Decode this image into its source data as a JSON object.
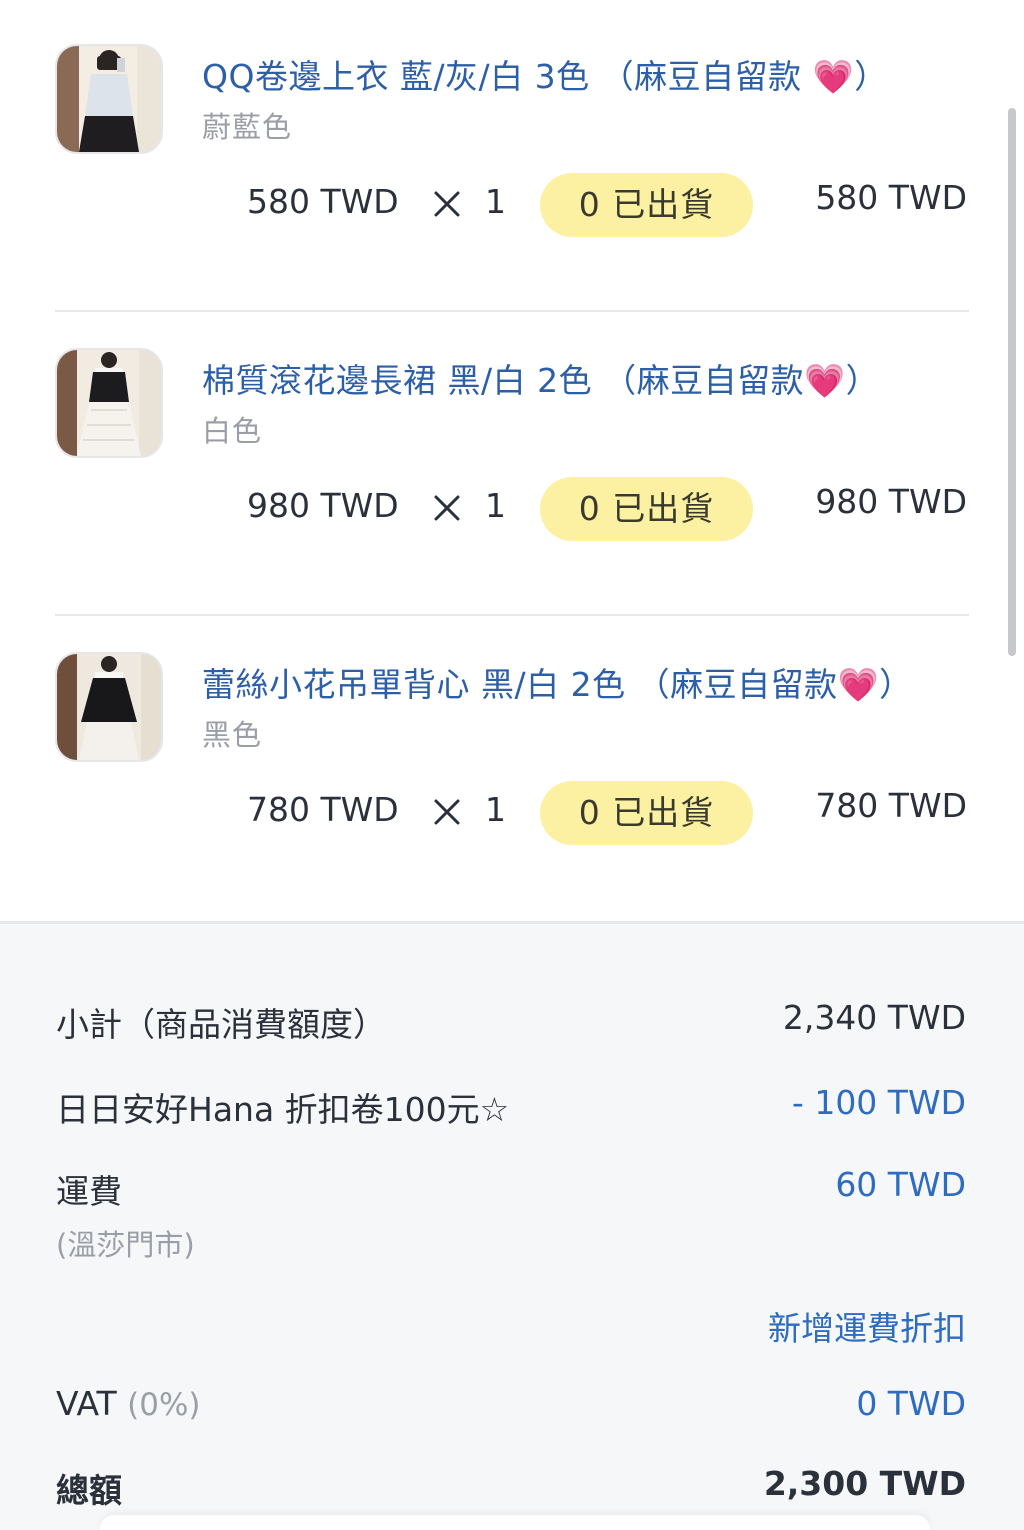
{
  "items": [
    {
      "title": "QQ卷邊上衣 藍/灰/白 3色 （麻豆自留款 💗）",
      "variant": "蔚藍色",
      "unit_price": "580 TWD",
      "times": "×",
      "quantity": "1",
      "status": "0 已出貨",
      "line_total": "580 TWD",
      "thumbnail_icon": "product-photo-blouse"
    },
    {
      "title": "棉質滾花邊長裙 黑/白 2色 （麻豆自留款💗）",
      "variant": "白色",
      "unit_price": "980 TWD",
      "times": "×",
      "quantity": "1",
      "status": "0 已出貨",
      "line_total": "980 TWD",
      "thumbnail_icon": "product-photo-skirt"
    },
    {
      "title": "蕾絲小花吊單背心 黑/白 2色 （麻豆自留款💗）",
      "variant": "黑色",
      "unit_price": "780 TWD",
      "times": "×",
      "quantity": "1",
      "status": "0 已出貨",
      "line_total": "780 TWD",
      "thumbnail_icon": "product-photo-camisole"
    }
  ],
  "summary": {
    "subtotal_label": "小計（商品消費額度）",
    "subtotal_value": "2,340 TWD",
    "coupon_label": "日日安好Hana 折扣卷100元☆",
    "coupon_value": "- 100 TWD",
    "shipping_label": "運費",
    "shipping_method": "(溫莎門市)",
    "shipping_value": "60 TWD",
    "add_shipping_discount": "新增運費折扣",
    "vat_label": "VAT",
    "vat_rate": "(0%)",
    "vat_value": "0 TWD",
    "total_label": "總額",
    "total_value": "2,300 TWD"
  },
  "colors": {
    "link_blue": "#2d5fa8",
    "value_blue": "#2d6cc0",
    "badge_yellow": "#fcf0a2",
    "text_dark": "#2b313b",
    "text_muted": "#9a9ea6"
  }
}
